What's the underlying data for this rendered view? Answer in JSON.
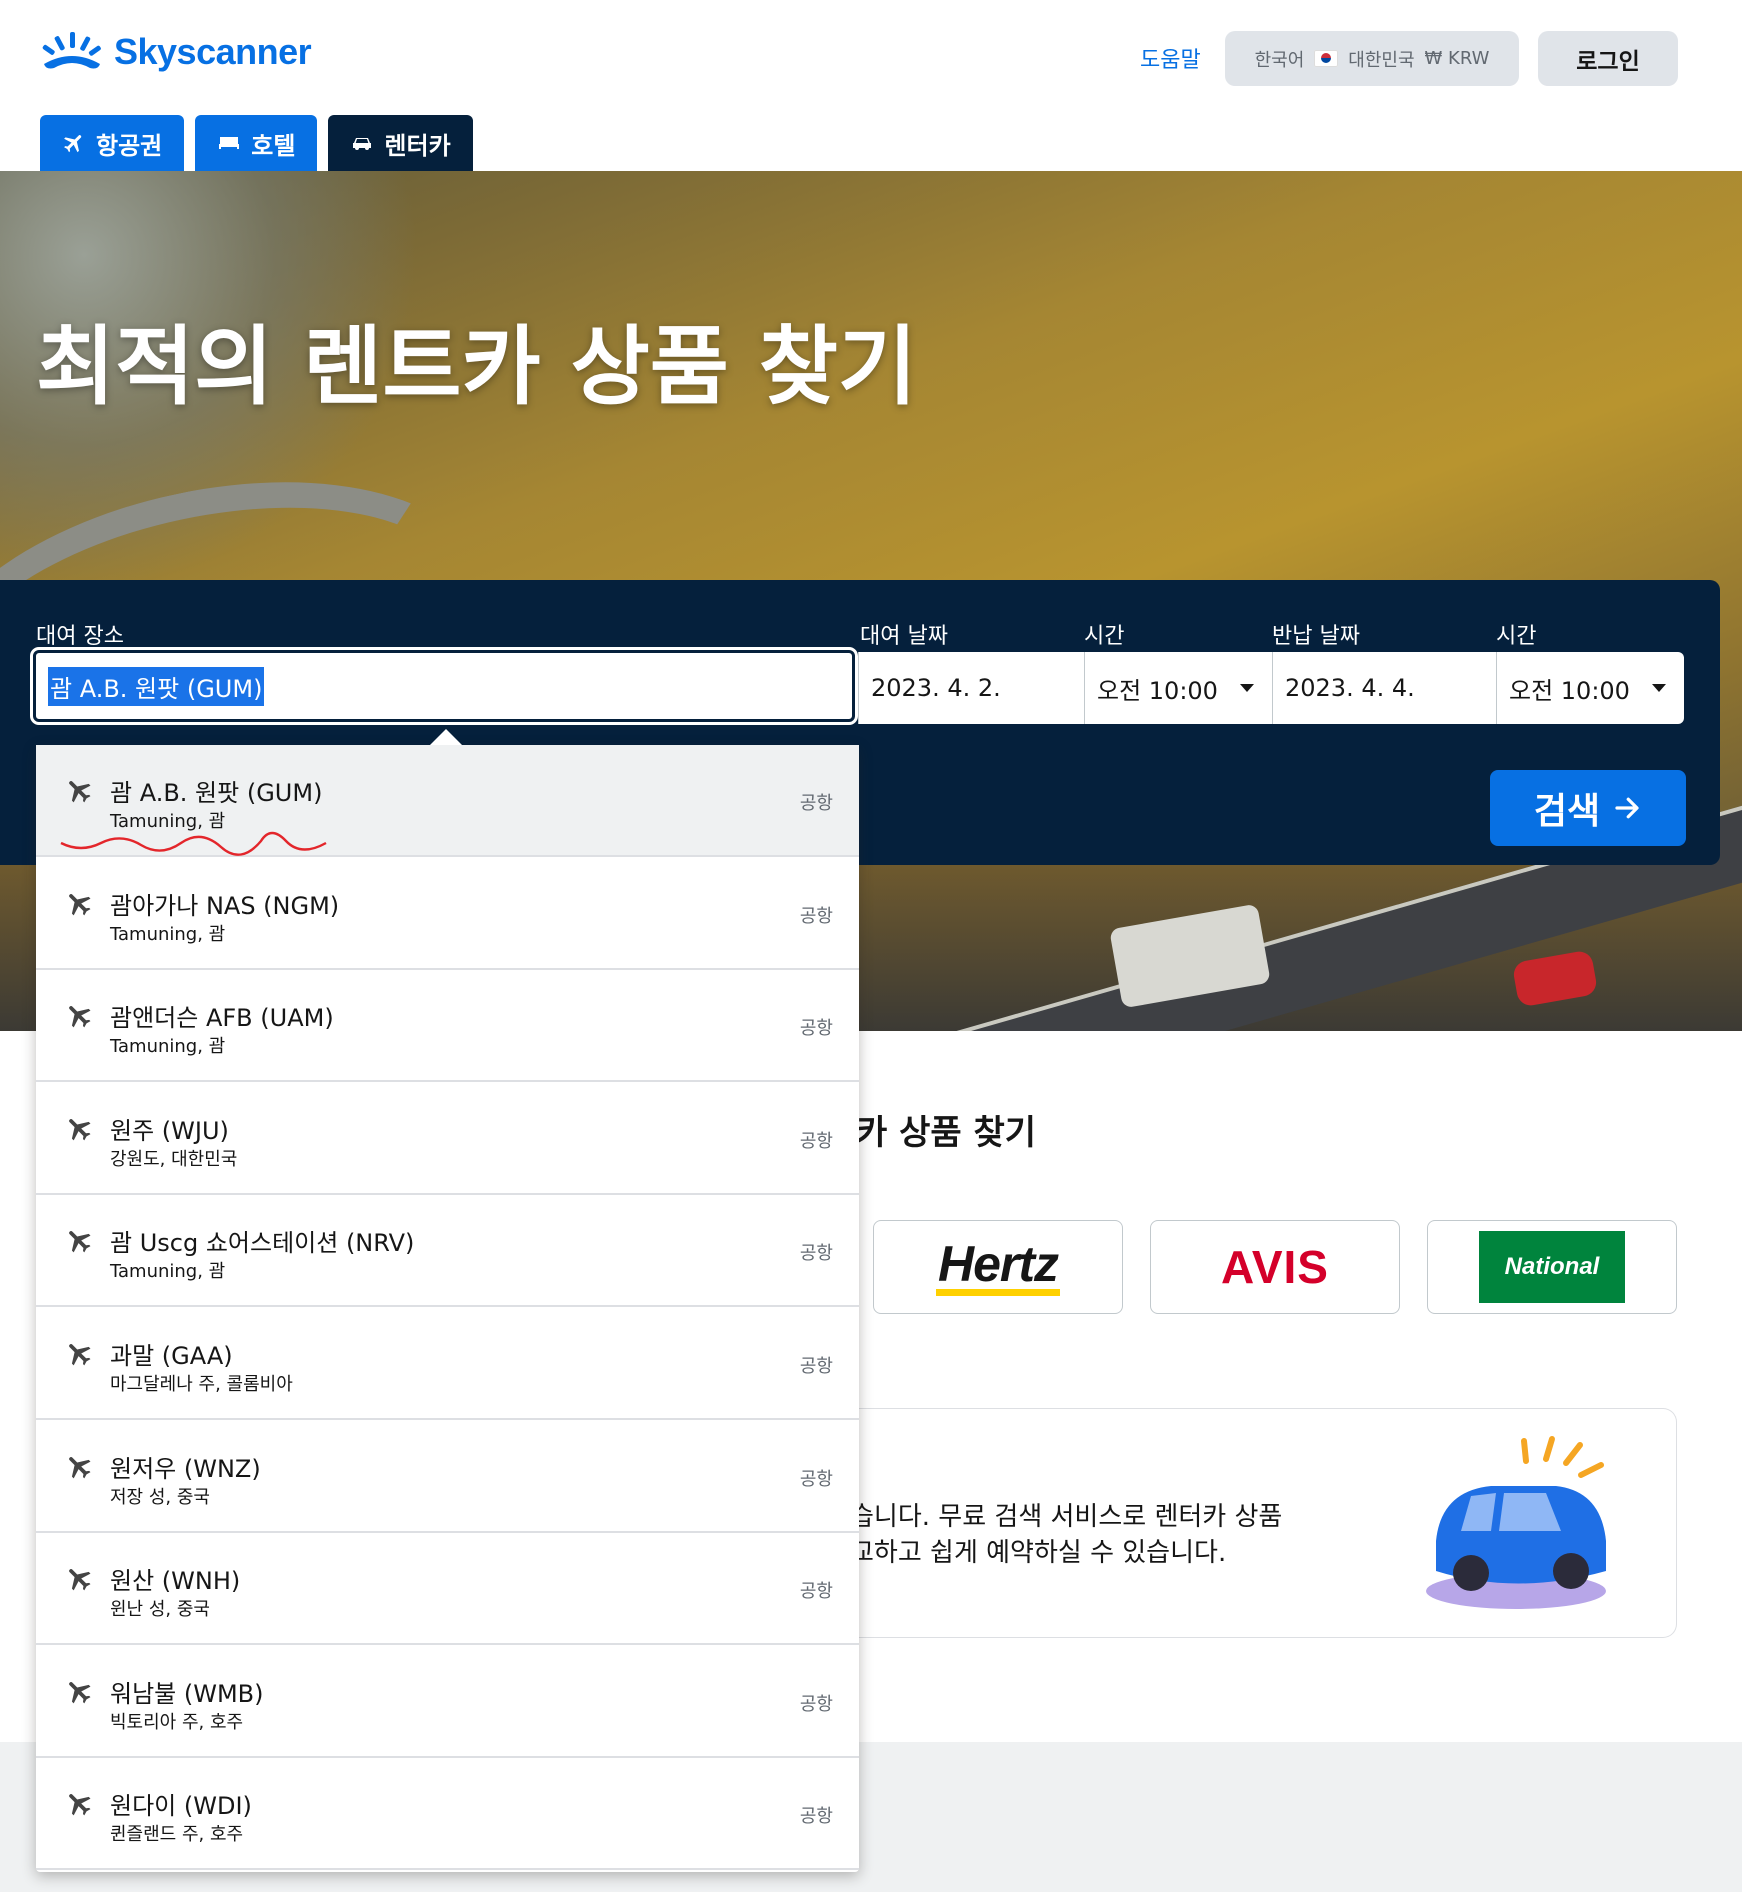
{
  "header": {
    "logo_text": "Skyscanner",
    "help_label": "도움말",
    "locale": {
      "language": "한국어",
      "country": "대한민국",
      "currency": "₩ KRW"
    },
    "login_label": "로그인"
  },
  "tabs": [
    {
      "label": "항공권",
      "icon": "plane-icon"
    },
    {
      "label": "호텔",
      "icon": "bed-icon"
    },
    {
      "label": "렌터카",
      "icon": "car-icon",
      "active": true
    }
  ],
  "hero": {
    "title": "최적의 렌트카 상품 찾기"
  },
  "search": {
    "location_label": "대여 장소",
    "location_value": "괌 A.B. 원팟 (GUM)",
    "pickup_date_label": "대여 날짜",
    "pickup_date": "2023. 4. 2.",
    "pickup_time_label": "시간",
    "pickup_time": "오전 10:00",
    "return_date_label": "반납 날짜",
    "return_date": "2023. 4. 4.",
    "return_time_label": "시간",
    "return_time": "오전 10:00",
    "search_button": "검색"
  },
  "content": {
    "partial_heading": "카 상품 찾기",
    "brands": [
      "Hertz",
      "AVIS",
      "National"
    ],
    "info_line1": "습니다. 무료 검색 서비스로 렌터카 상품",
    "info_line2": "교하고 쉽게 예약하실 수 있습니다."
  },
  "dropdown": {
    "items": [
      {
        "name": "괌 A.B. 원팟 (GUM)",
        "sub": "Tamuning, 괌",
        "type": "공항",
        "highlighted": true
      },
      {
        "name": "괌아가나 NAS (NGM)",
        "sub": "Tamuning, 괌",
        "type": "공항"
      },
      {
        "name": "괌앤더슨 AFB (UAM)",
        "sub": "Tamuning, 괌",
        "type": "공항"
      },
      {
        "name": "원주 (WJU)",
        "sub": "강원도, 대한민국",
        "type": "공항"
      },
      {
        "name": "괌 Uscg 쇼어스테이션 (NRV)",
        "sub": "Tamuning, 괌",
        "type": "공항"
      },
      {
        "name": "과말 (GAA)",
        "sub": "마그달레나 주, 콜롬비아",
        "type": "공항"
      },
      {
        "name": "원저우 (WNZ)",
        "sub": "저장 성, 중국",
        "type": "공항"
      },
      {
        "name": "원산 (WNH)",
        "sub": "윈난 성, 중국",
        "type": "공항"
      },
      {
        "name": "워남불 (WMB)",
        "sub": "빅토리아 주, 호주",
        "type": "공항"
      },
      {
        "name": "원다이 (WDI)",
        "sub": "퀸즐랜드 주, 호주",
        "type": "공항"
      }
    ]
  },
  "colors": {
    "brand_blue": "#0770e3",
    "panel_navy": "#05203c",
    "selection_blue": "#1a73e8"
  }
}
